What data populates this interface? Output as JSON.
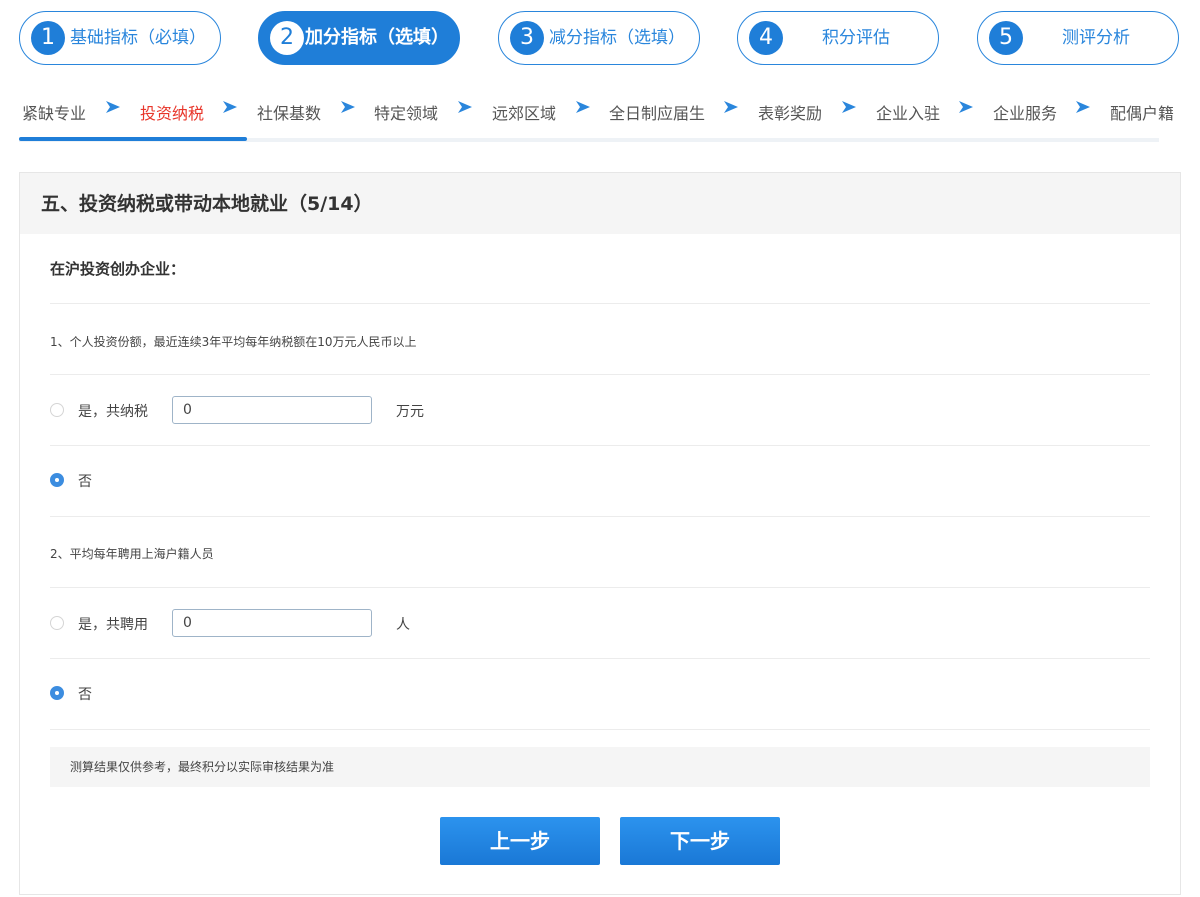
{
  "steps": [
    {
      "num": "1",
      "label": "基础指标（必填）"
    },
    {
      "num": "2",
      "label": "加分指标（选填）"
    },
    {
      "num": "3",
      "label": "减分指标（选填）"
    },
    {
      "num": "4",
      "label": "积分评估"
    },
    {
      "num": "5",
      "label": "测评分析"
    }
  ],
  "subnav": {
    "items": [
      "紧缺专业",
      "投资纳税",
      "社保基数",
      "特定领域",
      "远郊区域",
      "全日制应届生",
      "表彰奖励",
      "企业入驻",
      "企业服务",
      "配偶户籍"
    ],
    "active_index": 1
  },
  "section": {
    "title": "五、投资纳税或带动本地就业（5/14）",
    "subtitle": "在沪投资创办企业：",
    "q1": {
      "text": "1、个人投资份额，最近连续3年平均每年纳税额在10万元人民币以上",
      "yes_label": "是，共纳税",
      "value": "0",
      "unit": "万元",
      "no_label": "否",
      "selected": "no"
    },
    "q2": {
      "text": "2、平均每年聘用上海户籍人员",
      "yes_label": "是，共聘用",
      "value": "0",
      "unit": "人",
      "no_label": "否",
      "selected": "no"
    },
    "note": "测算结果仅供参考，最终积分以实际审核结果为准"
  },
  "buttons": {
    "prev": "上一步",
    "next": "下一步"
  },
  "colors": {
    "accent": "#1f7ed8",
    "active_tab": "#e8362b"
  }
}
